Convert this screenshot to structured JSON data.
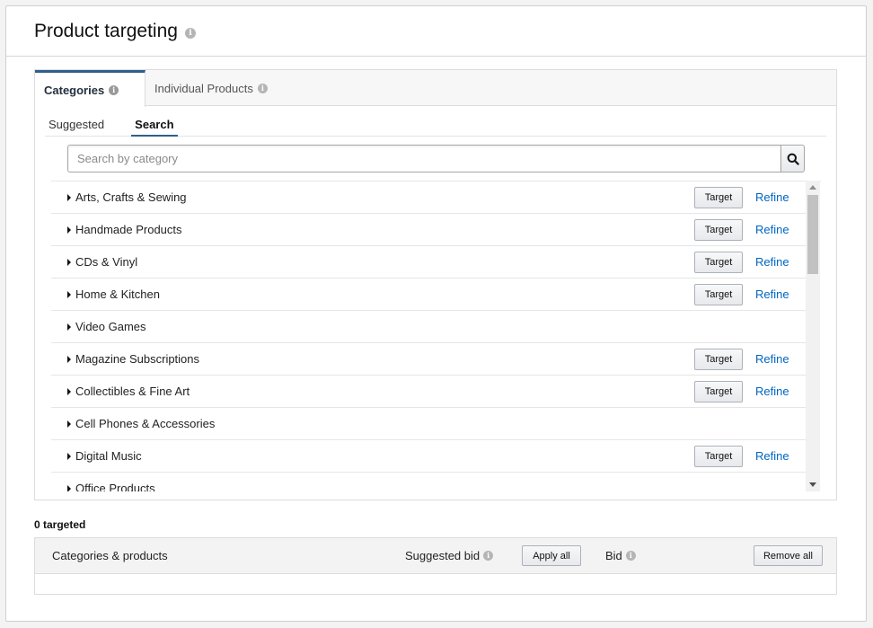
{
  "header": {
    "title": "Product targeting"
  },
  "tabs": [
    {
      "label": "Categories",
      "active": true
    },
    {
      "label": "Individual Products",
      "active": false
    }
  ],
  "subtabs": [
    {
      "label": "Suggested",
      "active": false
    },
    {
      "label": "Search",
      "active": true
    }
  ],
  "search": {
    "placeholder": "Search by category",
    "value": ""
  },
  "categories": [
    {
      "label": "Arts, Crafts & Sewing",
      "target": "Target",
      "refine": "Refine"
    },
    {
      "label": "Handmade Products",
      "target": "Target",
      "refine": "Refine"
    },
    {
      "label": "CDs & Vinyl",
      "target": "Target",
      "refine": "Refine"
    },
    {
      "label": "Home & Kitchen",
      "target": "Target",
      "refine": "Refine"
    },
    {
      "label": "Video Games"
    },
    {
      "label": "Magazine Subscriptions",
      "target": "Target",
      "refine": "Refine"
    },
    {
      "label": "Collectibles & Fine Art",
      "target": "Target",
      "refine": "Refine"
    },
    {
      "label": "Cell Phones & Accessories"
    },
    {
      "label": "Digital Music",
      "target": "Target",
      "refine": "Refine"
    },
    {
      "label": "Office Products"
    }
  ],
  "targeted": {
    "count_label": "0 targeted"
  },
  "table": {
    "col_categories": "Categories & products",
    "col_suggested_bid": "Suggested bid",
    "apply_all": "Apply all",
    "col_bid": "Bid",
    "remove_all": "Remove all"
  },
  "colors": {
    "link": "#0066c0",
    "active_tab": "#2f5f8a"
  }
}
